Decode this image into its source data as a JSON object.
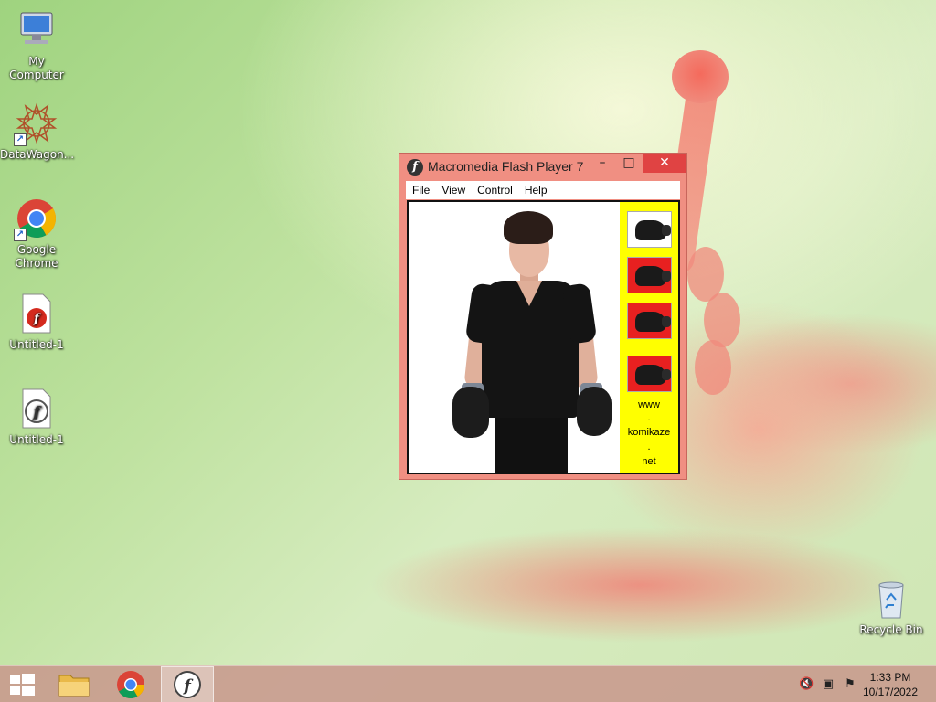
{
  "desktop": {
    "icons": [
      {
        "label": "My Computer"
      },
      {
        "label": "DataWagon..."
      },
      {
        "label": "Google Chrome"
      },
      {
        "label": "Untitled-1"
      },
      {
        "label": "Untitled-1"
      },
      {
        "label": "Recycle Bin"
      }
    ]
  },
  "window": {
    "title": "Macromedia Flash Player 7",
    "controls": {
      "minimize": "–",
      "maximize": "□",
      "close": "✕"
    },
    "menu": [
      "File",
      "View",
      "Control",
      "Help"
    ],
    "sidebar_text": [
      "www",
      ".",
      "komikaze",
      ".",
      "net"
    ]
  },
  "taskbar": {
    "time": "1:33 PM",
    "date": "10/17/2022"
  },
  "colors": {
    "window_frame": "#f08f82",
    "close_button": "#e04343",
    "sidebar_yellow": "#ffff00",
    "thumb_red": "#e82020"
  }
}
